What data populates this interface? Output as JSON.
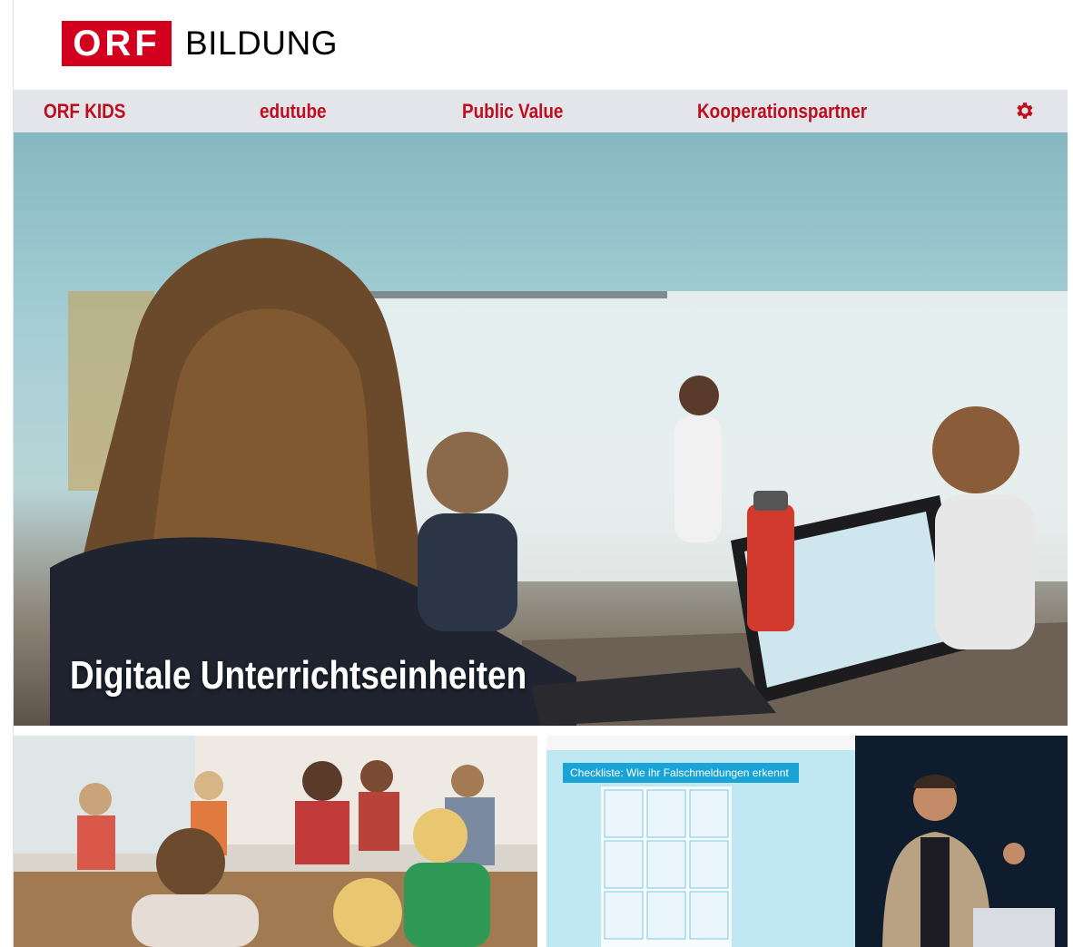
{
  "header": {
    "logo_orf": "ORF",
    "logo_word": "BILDUNG"
  },
  "nav": {
    "items": [
      {
        "label": "ORF KIDS"
      },
      {
        "label": "edutube"
      },
      {
        "label": "Public Value"
      },
      {
        "label": "Kooperationspartner"
      }
    ],
    "settings_icon": "gear-icon"
  },
  "hero": {
    "title": "Digitale Unterrichtseinheiten"
  },
  "tiles": {
    "right": {
      "checklist_title": "Checkliste: Wie ihr Falschmeldungen erkennt"
    }
  },
  "colors": {
    "brand_red": "#d2001e",
    "nav_text": "#c00d1e",
    "nav_bg": "#e3e5ea"
  }
}
